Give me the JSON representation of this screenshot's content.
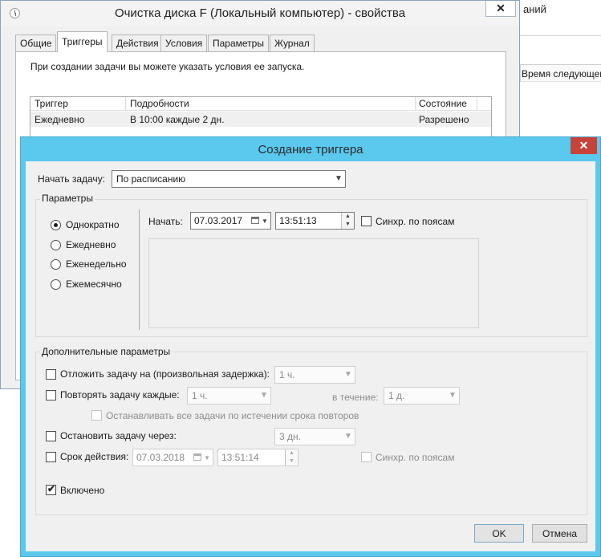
{
  "background": {
    "header_fragment": "аний",
    "column_header": "Время следующего"
  },
  "properties_window": {
    "title": "Очистка диска F (Локальный компьютер) - свойства",
    "close_glyph": "✕",
    "tabs": [
      "Общие",
      "Триггеры",
      "Действия",
      "Условия",
      "Параметры",
      "Журнал"
    ],
    "active_tab": "Триггеры",
    "info_text": "При создании задачи вы можете указать условия ее запуска.",
    "grid": {
      "columns": [
        "Триггер",
        "Подробности",
        "Состояние"
      ],
      "rows": [
        {
          "trigger": "Ежедневно",
          "details": "В 10:00 каждые 2 дн.",
          "state": "Разрешено"
        }
      ]
    }
  },
  "dialog": {
    "title": "Создание триггера",
    "close_glyph": "✕",
    "start_task": {
      "label": "Начать задачу:",
      "value": "По расписанию"
    },
    "params": {
      "group_label": "Параметры",
      "options": [
        "Однократно",
        "Ежедневно",
        "Еженедельно",
        "Ежемесячно"
      ],
      "selected": "Однократно",
      "start_label": "Начать:",
      "start_date": "07.03.2017",
      "start_time": "13:51:13",
      "sync_label": "Синхр. по поясам",
      "sync_checked": false
    },
    "advanced": {
      "group_label": "Дополнительные параметры",
      "delay": {
        "label": "Отложить задачу на (произвольная задержка):",
        "checked": false,
        "value": "1 ч."
      },
      "repeat": {
        "label": "Повторять задачу каждые:",
        "checked": false,
        "value": "1 ч.",
        "duration_label": "в течение:",
        "duration_value": "1 д."
      },
      "stop_all": {
        "label": "Останавливать все задачи по истечении срока повторов",
        "checked": false
      },
      "stop_after": {
        "label": "Остановить задачу через:",
        "checked": false,
        "value": "3 дн."
      },
      "expire": {
        "label": "Срок действия:",
        "checked": false,
        "date": "07.03.2018",
        "time": "13:51:14",
        "sync_label": "Синхр. по поясам"
      },
      "enabled": {
        "label": "Включено",
        "checked": true
      }
    },
    "buttons": {
      "ok": "OK",
      "cancel": "Отмена"
    }
  }
}
